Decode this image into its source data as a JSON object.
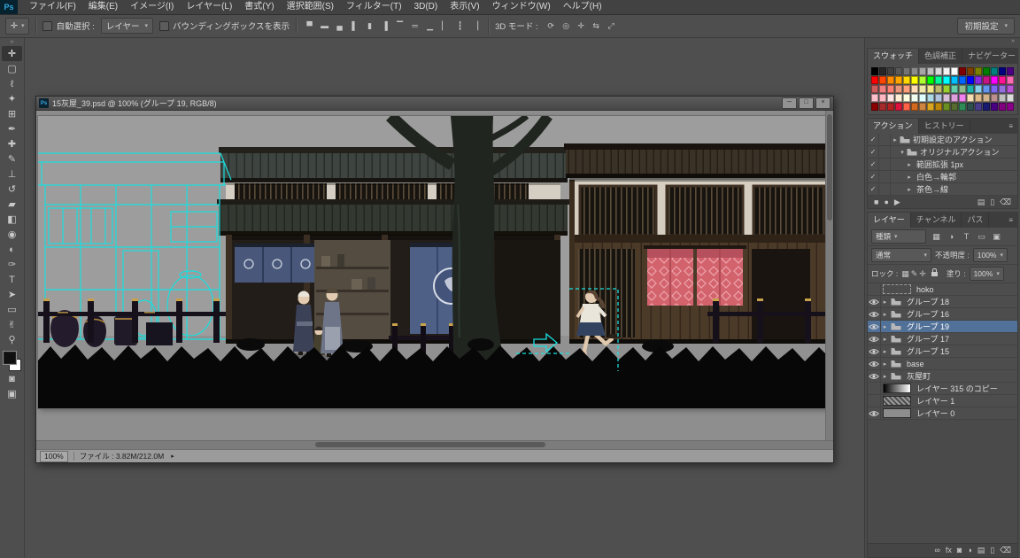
{
  "app": {
    "logo": "Ps",
    "menus": [
      "ファイル(F)",
      "編集(E)",
      "イメージ(I)",
      "レイヤー(L)",
      "書式(Y)",
      "選択範囲(S)",
      "フィルター(T)",
      "3D(D)",
      "表示(V)",
      "ウィンドウ(W)",
      "ヘルプ(H)"
    ],
    "workspace": "初期設定"
  },
  "options": {
    "auto_select_label": "自動選択 :",
    "auto_select_value": "レイヤー",
    "bbox_label": "バウンディングボックスを表示",
    "mode3d_label": "3D モード :",
    "align_icons": [
      {
        "name": "align-top-edges",
        "glyph": "▀"
      },
      {
        "name": "align-vertical-centers",
        "glyph": "▬"
      },
      {
        "name": "align-bottom-edges",
        "glyph": "▄"
      },
      {
        "name": "align-left-edges",
        "glyph": "▌"
      },
      {
        "name": "align-horizontal-centers",
        "glyph": "▮"
      },
      {
        "name": "align-right-edges",
        "glyph": "▐"
      },
      {
        "name": "distribute-top-edges",
        "glyph": "▔"
      },
      {
        "name": "distribute-vertical-centers",
        "glyph": "═"
      },
      {
        "name": "distribute-bottom-edges",
        "glyph": "▁"
      },
      {
        "name": "distribute-left-edges",
        "glyph": "▏"
      },
      {
        "name": "distribute-horizontal-centers",
        "glyph": "┇"
      },
      {
        "name": "distribute-right-edges",
        "glyph": "▕"
      }
    ],
    "mode3d_icons": [
      {
        "name": "3d-orbit-icon",
        "glyph": "⟳"
      },
      {
        "name": "3d-roll-icon",
        "glyph": "◎"
      },
      {
        "name": "3d-pan-icon",
        "glyph": "✛"
      },
      {
        "name": "3d-slide-icon",
        "glyph": "⇆"
      },
      {
        "name": "3d-scale-icon",
        "glyph": "⤢"
      }
    ]
  },
  "tools": [
    {
      "name": "move-tool",
      "glyph": "✛"
    },
    {
      "name": "marquee-tool",
      "glyph": "▢"
    },
    {
      "name": "lasso-tool",
      "glyph": "ℓ"
    },
    {
      "name": "quick-selection-tool",
      "glyph": "✦"
    },
    {
      "name": "crop-tool",
      "glyph": "⊞"
    },
    {
      "name": "eyedropper-tool",
      "glyph": "✒"
    },
    {
      "name": "healing-brush-tool",
      "glyph": "✚"
    },
    {
      "name": "brush-tool",
      "glyph": "✎"
    },
    {
      "name": "clone-stamp-tool",
      "glyph": "⊥"
    },
    {
      "name": "history-brush-tool",
      "glyph": "↺"
    },
    {
      "name": "eraser-tool",
      "glyph": "▰"
    },
    {
      "name": "gradient-tool",
      "glyph": "◧"
    },
    {
      "name": "blur-tool",
      "glyph": "◉"
    },
    {
      "name": "dodge-tool",
      "glyph": "◐"
    },
    {
      "name": "pen-tool",
      "glyph": "✑"
    },
    {
      "name": "type-tool",
      "glyph": "T"
    },
    {
      "name": "path-selection-tool",
      "glyph": "➤"
    },
    {
      "name": "rectangle-tool",
      "glyph": "▭"
    },
    {
      "name": "hand-tool",
      "glyph": "✌"
    },
    {
      "name": "zoom-tool",
      "glyph": "⚲"
    }
  ],
  "toolbar_extras": {
    "fg_color": "#101010",
    "bg_color": "#ffffff",
    "quick_mask_glyph": "◙",
    "screen_mode_glyph": "▣"
  },
  "window": {
    "title": "15灰屋_39.psd @ 100% (グループ 19, RGB/8)",
    "buttons": {
      "minimize": "─",
      "maximize": "□",
      "close": "×"
    },
    "zoom": "100%",
    "status": "ファイル : 3.82M/212.0M",
    "status_arrow": "▸"
  },
  "panels": {
    "swatches": {
      "tabs": [
        "スウォッチ",
        "色調補正",
        "ナビゲーター"
      ],
      "palette": [
        "#000000",
        "#262626",
        "#404040",
        "#595959",
        "#737373",
        "#8c8c8c",
        "#a6a6a6",
        "#bfbfbf",
        "#d9d9d9",
        "#f2f2f2",
        "#ffffff",
        "#7f0000",
        "#7f3f00",
        "#7f7f00",
        "#007f00",
        "#007f7f",
        "#00007f",
        "#4b0082",
        "#ff0000",
        "#ff4500",
        "#ff8c00",
        "#ffa500",
        "#ffd700",
        "#ffff00",
        "#adff2f",
        "#00ff00",
        "#00fa9a",
        "#00ffff",
        "#00bfff",
        "#0066ff",
        "#0000ff",
        "#8a2be2",
        "#c71585",
        "#ff00ff",
        "#ff1493",
        "#ff69b4",
        "#cd5c5c",
        "#f08080",
        "#fa8072",
        "#e9967a",
        "#ffa07a",
        "#ffdab9",
        "#eee8aa",
        "#f0e68c",
        "#bdb76b",
        "#9acd32",
        "#66cdaa",
        "#8fbc8f",
        "#20b2aa",
        "#87ceeb",
        "#6495ed",
        "#7b68ee",
        "#9370db",
        "#ba55d3",
        "#ffc0cb",
        "#ffb6c1",
        "#ffe4e1",
        "#ffefd5",
        "#ffffe0",
        "#f0fff0",
        "#e0ffff",
        "#add8e6",
        "#b0c4de",
        "#d8bfd8",
        "#dda0dd",
        "#ee82ee",
        "#f5deb3",
        "#deb887",
        "#d2b48c",
        "#bc8f8f",
        "#c0c0c0",
        "#dcdcdc",
        "#8b0000",
        "#a52a2a",
        "#b22222",
        "#dc143c",
        "#ff6347",
        "#d2691e",
        "#cd853f",
        "#daa520",
        "#b8860b",
        "#6b8e23",
        "#556b2f",
        "#2e8b57",
        "#2f4f4f",
        "#483d8b",
        "#191970",
        "#4b0082",
        "#800080",
        "#8b008b"
      ]
    },
    "actions": {
      "tabs": [
        "アクション",
        "ヒストリー"
      ],
      "rows": [
        {
          "check": "✓",
          "expander": "▸",
          "folder": true,
          "label": "初期設定のアクション",
          "indent": 0
        },
        {
          "check": "✓",
          "expander": "▾",
          "folder": true,
          "label": "オリジナルアクション",
          "indent": 1
        },
        {
          "check": "✓",
          "expander": "▸",
          "folder": false,
          "label": "範囲拡張 1px",
          "indent": 2
        },
        {
          "check": "✓",
          "expander": "▸",
          "folder": false,
          "label": "白色→輪郭",
          "indent": 2
        },
        {
          "check": "✓",
          "expander": "▸",
          "folder": false,
          "label": "茶色→線",
          "indent": 2
        }
      ],
      "footer": [
        {
          "name": "stop-icon",
          "glyph": "■"
        },
        {
          "name": "record-icon",
          "glyph": "●"
        },
        {
          "name": "play-icon",
          "glyph": "▶"
        },
        {
          "name": "new-set-icon",
          "glyph": "▤"
        },
        {
          "name": "new-action-icon",
          "glyph": "▯"
        },
        {
          "name": "delete-action-icon",
          "glyph": "⌫"
        }
      ]
    },
    "layers": {
      "tabs": [
        "レイヤー",
        "チャンネル",
        "パス"
      ],
      "filter_label": "種類",
      "filter_icons": [
        {
          "name": "filter-pixel-icon",
          "glyph": "▦"
        },
        {
          "name": "filter-adjustment-icon",
          "glyph": "◑"
        },
        {
          "name": "filter-type-icon",
          "glyph": "T"
        },
        {
          "name": "filter-shape-icon",
          "glyph": "▭"
        },
        {
          "name": "filter-smart-icon",
          "glyph": "▣"
        }
      ],
      "blend_mode": "通常",
      "opacity_label": "不透明度 :",
      "opacity_value": "100%",
      "lock_label": "ロック :",
      "lock_icons": [
        {
          "name": "lock-transparent-icon",
          "glyph": "▦"
        },
        {
          "name": "lock-pixels-icon",
          "glyph": "✎"
        },
        {
          "name": "lock-position-icon",
          "glyph": "✛"
        }
      ],
      "fill_label": "塗り :",
      "fill_value": "100%",
      "rows": [
        {
          "label": "hoko",
          "eye": false,
          "kind": "empty",
          "selected": false
        },
        {
          "label": "グループ 18",
          "eye": true,
          "kind": "group",
          "selected": false
        },
        {
          "label": "グループ 16",
          "eye": true,
          "kind": "group",
          "selected": false
        },
        {
          "label": "グループ 19",
          "eye": true,
          "kind": "group",
          "selected": true
        },
        {
          "label": "グループ 17",
          "eye": true,
          "kind": "group",
          "selected": false
        },
        {
          "label": "グループ 15",
          "eye": true,
          "kind": "group",
          "selected": false
        },
        {
          "label": "base",
          "eye": true,
          "kind": "group",
          "selected": false
        },
        {
          "label": "灰屋町",
          "eye": true,
          "kind": "group",
          "selected": false
        },
        {
          "label": "レイヤー 315 のコピー",
          "eye": false,
          "kind": "gradient",
          "selected": false
        },
        {
          "label": "レイヤー 1",
          "eye": false,
          "kind": "pattern",
          "selected": false
        },
        {
          "label": "レイヤー 0",
          "eye": true,
          "kind": "flat",
          "selected": false
        }
      ],
      "footer": [
        {
          "name": "link-layers-icon",
          "glyph": "∞"
        },
        {
          "name": "layer-style-icon",
          "glyph": "fx"
        },
        {
          "name": "add-layer-mask-icon",
          "glyph": "◙"
        },
        {
          "name": "new-adjustment-layer-icon",
          "glyph": "◑"
        },
        {
          "name": "new-group-icon",
          "glyph": "▤"
        },
        {
          "name": "new-layer-icon",
          "glyph": "▯"
        },
        {
          "name": "delete-layer-icon",
          "glyph": "⌫"
        }
      ]
    }
  }
}
